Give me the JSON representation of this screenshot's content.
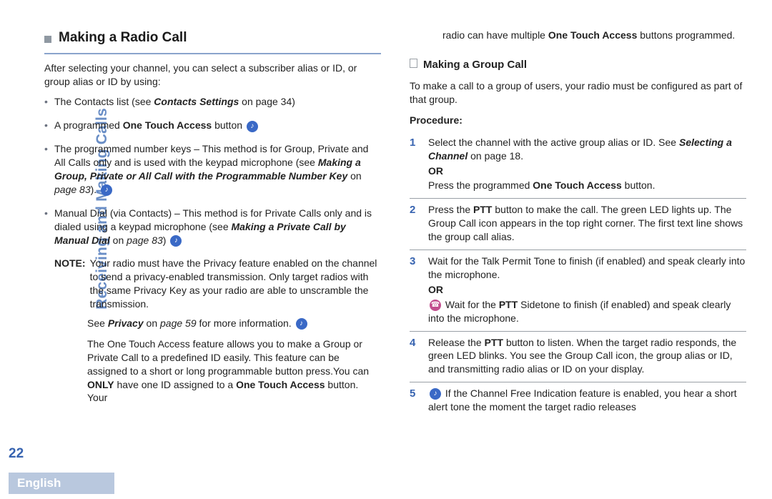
{
  "sidebar_label": "Receiving and Making Calls",
  "page_number": "22",
  "language": "English",
  "left": {
    "h1": "Making a Radio Call",
    "intro": "After selecting your channel, you can select a subscriber alias or ID, or group alias or ID by using:",
    "bullets": {
      "b1_a": "The Contacts list (see ",
      "b1_b": "Contacts Settings",
      "b1_c": " on page 34)",
      "b2_a": "A programmed ",
      "b2_b": "One Touch Access",
      "b2_c": " button ",
      "b3_a": "The programmed number keys – This method is for Group, Private and All Calls only and is used with the keypad microphone (see ",
      "b3_b": "Making a Group, Private or All Call with the Programmable Number Key",
      "b3_c": " on ",
      "b3_d": "page 83",
      "b3_e": "). ",
      "b4_a": "Manual Dial (via Contacts) – This method is for Private Calls only and is dialed using a keypad microphone (see ",
      "b4_b": "Making a Private Call by Manual Dial",
      "b4_c": " on ",
      "b4_d": "page 83",
      "b4_e": ") "
    },
    "note": {
      "label": "NOTE:",
      "p1": "Your radio must have the Privacy feature enabled on the channel to send a privacy-enabled transmission. Only target radios with the same Privacy Key as your radio are able to unscramble the transmission.",
      "p2_a": "See ",
      "p2_b": "Privacy",
      "p2_c": " on ",
      "p2_d": "page 59",
      "p2_e": " for more information. ",
      "p3_a": "The One Touch Access feature allows you to make a Group or Private Call to a predefined ID easily. This feature can be assigned to a short or long programmable button press.You can ",
      "p3_b": "ONLY",
      "p3_c": " have one ID assigned to a ",
      "p3_d": "One Touch Access",
      "p3_e": " button. Your "
    }
  },
  "right": {
    "cont_a": "radio can have multiple ",
    "cont_b": "One Touch Access",
    "cont_c": " buttons programmed.",
    "h2": "Making a Group Call",
    "p1": "To make a call to a group of users, your radio must be configured as part of that group.",
    "proc_label": "Procedure:",
    "steps": {
      "s1_a": "Select the channel with the active group alias or ID. See ",
      "s1_b": "Selecting a Channel",
      "s1_c": " on page 18.",
      "s1_or": "OR",
      "s1_d": "Press the programmed ",
      "s1_e": "One Touch Access",
      "s1_f": " button.",
      "s2_a": "Press the ",
      "s2_b": "PTT",
      "s2_c": " button to make the call. The green LED lights up. The Group Call icon appears in the top right corner. The first text line shows the group call alias.",
      "s3_a": "Wait for the Talk Permit Tone to finish (if enabled) and speak clearly into the microphone.",
      "s3_or": "OR",
      "s3_b": " Wait for the ",
      "s3_c": "PTT",
      "s3_d": " Sidetone to finish (if enabled) and speak clearly into the microphone.",
      "s4_a": "Release the ",
      "s4_b": "PTT",
      "s4_c": " button to listen. When the target radio responds, the green LED blinks. You see the Group Call icon, the group alias or ID, and transmitting radio alias or ID on your display.",
      "s5_a": " If the Channel Free Indication feature is enabled, you hear a short alert tone the moment the target radio releases"
    }
  }
}
